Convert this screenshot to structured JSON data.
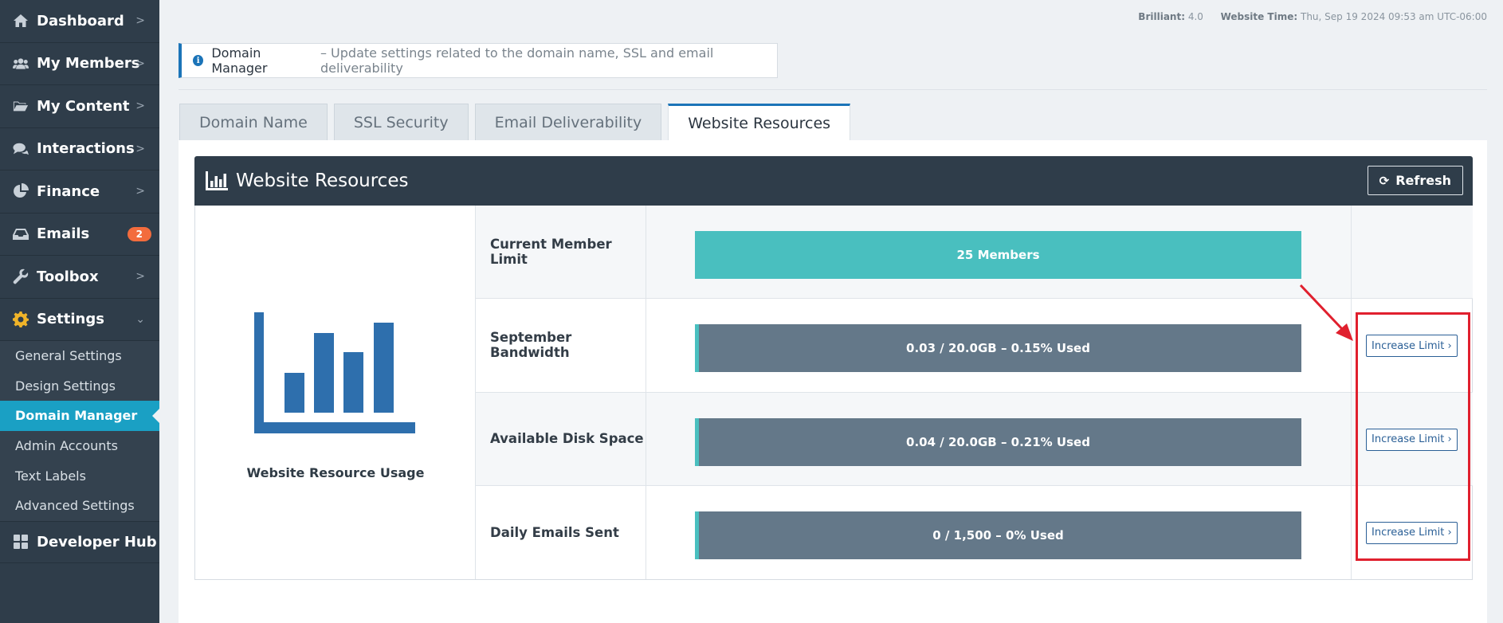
{
  "sidebar": {
    "items": [
      {
        "label": "Dashboard",
        "icon": "home-icon"
      },
      {
        "label": "My Members",
        "icon": "users-icon"
      },
      {
        "label": "My Content",
        "icon": "folder-open-icon"
      },
      {
        "label": "Interactions",
        "icon": "comments-icon"
      },
      {
        "label": "Finance",
        "icon": "pie-chart-icon"
      },
      {
        "label": "Emails",
        "icon": "inbox-icon",
        "badge": "2"
      },
      {
        "label": "Toolbox",
        "icon": "wrench-icon"
      },
      {
        "label": "Settings",
        "icon": "gear-icon"
      }
    ],
    "sub_items": [
      "General Settings",
      "Design Settings",
      "Domain Manager",
      "Admin Accounts",
      "Text Labels",
      "Advanced Settings"
    ],
    "developer_hub": "Developer Hub"
  },
  "topbar": {
    "brilliant_label": "Brilliant:",
    "brilliant_value": "4.0",
    "time_label": "Website Time:",
    "time_value": "Thu, Sep 19 2024 09:53 am UTC-06:00"
  },
  "info": {
    "title": "Domain Manager",
    "description": "– Update settings related to the domain name, SSL and email deliverability"
  },
  "tabs": [
    "Domain Name",
    "SSL Security",
    "Email Deliverability",
    "Website Resources"
  ],
  "card": {
    "title": "Website Resources",
    "refresh_label": "Refresh",
    "left_label": "Website Resource Usage"
  },
  "resources": [
    {
      "label": "Current Member Limit",
      "bar_text": "25 Members",
      "fill_percent": 100,
      "button": ""
    },
    {
      "label": "September Bandwidth",
      "bar_text": "0.03 / 20.0GB – 0.15% Used",
      "fill_percent": 0.15,
      "button": "Increase Limit ›"
    },
    {
      "label": "Available Disk Space",
      "bar_text": "0.04 / 20.0GB – 0.21% Used",
      "fill_percent": 0.21,
      "button": "Increase Limit ›"
    },
    {
      "label": "Daily Emails Sent",
      "bar_text": "0 / 1,500 – 0% Used",
      "fill_percent": 0,
      "button": "Increase Limit ›"
    }
  ],
  "colors": {
    "sidebar_bg": "#2f3d4a",
    "active_item": "#1aa0c4",
    "bar_fill": "#49bfbf",
    "bar_bg": "#647889",
    "chart_icon": "#2e6fad",
    "annotation": "#e0202e"
  }
}
